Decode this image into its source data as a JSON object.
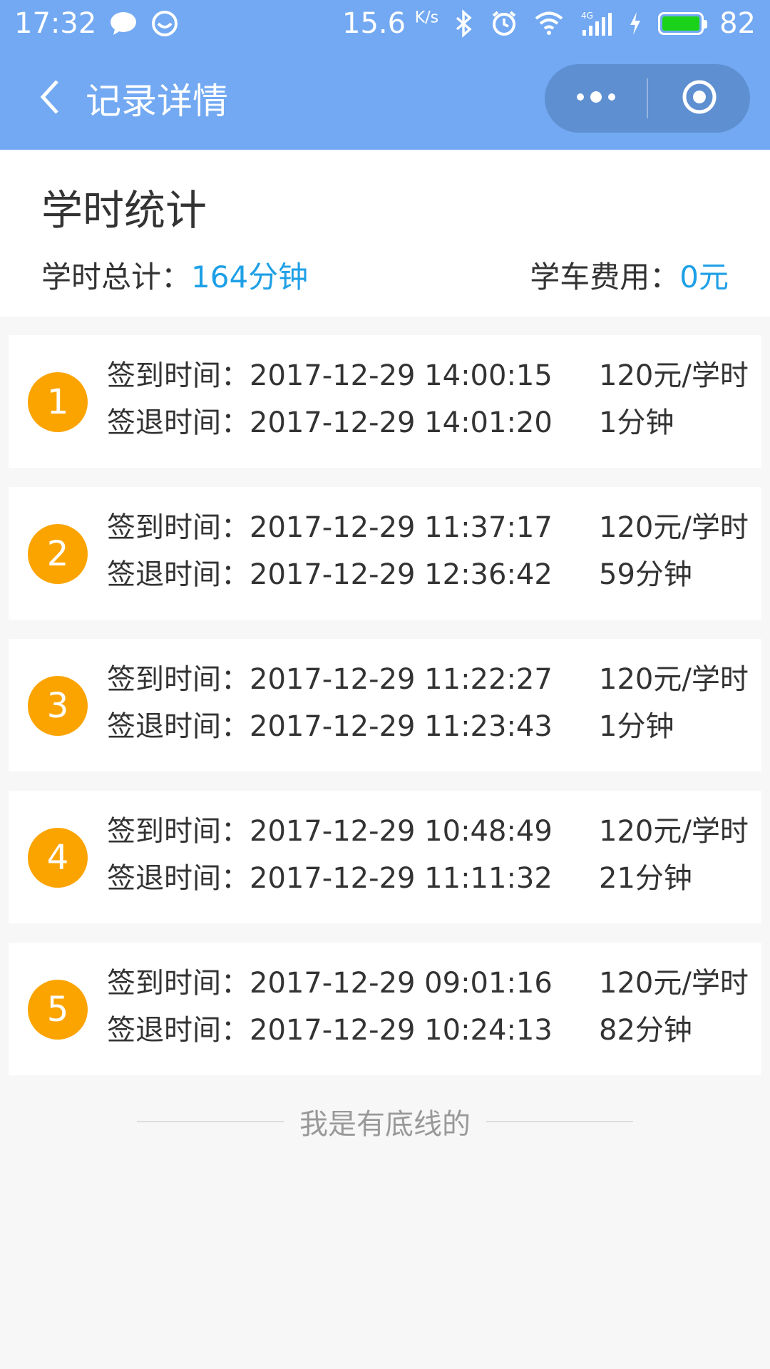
{
  "status_bar": {
    "time": "17:32",
    "speed": "15.6",
    "speed_unit": "K/s",
    "signal_type": "4G",
    "battery": "82",
    "icons": [
      "chat-bubble-icon",
      "messenger-icon",
      "bluetooth-icon",
      "alarm-icon",
      "wifi-icon",
      "cellular-signal-icon",
      "charging-icon",
      "battery-icon"
    ],
    "battery_color": "#19d219"
  },
  "nav": {
    "title": "记录详情",
    "back_icon": "chevron-left-icon",
    "more_icon": "more-dots-icon",
    "close_icon": "target-circle-icon"
  },
  "summary": {
    "title": "学时统计",
    "total_label": "学时总计：",
    "total_value": "164分钟",
    "fee_label": "学车费用：",
    "fee_value": "0元"
  },
  "records": [
    {
      "index": "1",
      "checkin_label": "签到时间：",
      "checkin": "2017-12-29 14:00:15",
      "checkout_label": "签退时间：",
      "checkout": "2017-12-29 14:01:20",
      "rate": "120元/学时",
      "duration": "1分钟"
    },
    {
      "index": "2",
      "checkin_label": "签到时间：",
      "checkin": "2017-12-29 11:37:17",
      "checkout_label": "签退时间：",
      "checkout": "2017-12-29 12:36:42",
      "rate": "120元/学时",
      "duration": "59分钟"
    },
    {
      "index": "3",
      "checkin_label": "签到时间：",
      "checkin": "2017-12-29 11:22:27",
      "checkout_label": "签退时间：",
      "checkout": "2017-12-29 11:23:43",
      "rate": "120元/学时",
      "duration": "1分钟"
    },
    {
      "index": "4",
      "checkin_label": "签到时间：",
      "checkin": "2017-12-29 10:48:49",
      "checkout_label": "签退时间：",
      "checkout": "2017-12-29 11:11:32",
      "rate": "120元/学时",
      "duration": "21分钟"
    },
    {
      "index": "5",
      "checkin_label": "签到时间：",
      "checkin": "2017-12-29 09:01:16",
      "checkout_label": "签退时间：",
      "checkout": "2017-12-29 10:24:13",
      "rate": "120元/学时",
      "duration": "82分钟"
    }
  ],
  "footer": {
    "text": "我是有底线的"
  },
  "colors": {
    "header": "#72a9f2",
    "capsule": "#5d8fd1",
    "accent": "#1ea0e6",
    "badge": "#fba400",
    "background": "#f7f7f7"
  }
}
